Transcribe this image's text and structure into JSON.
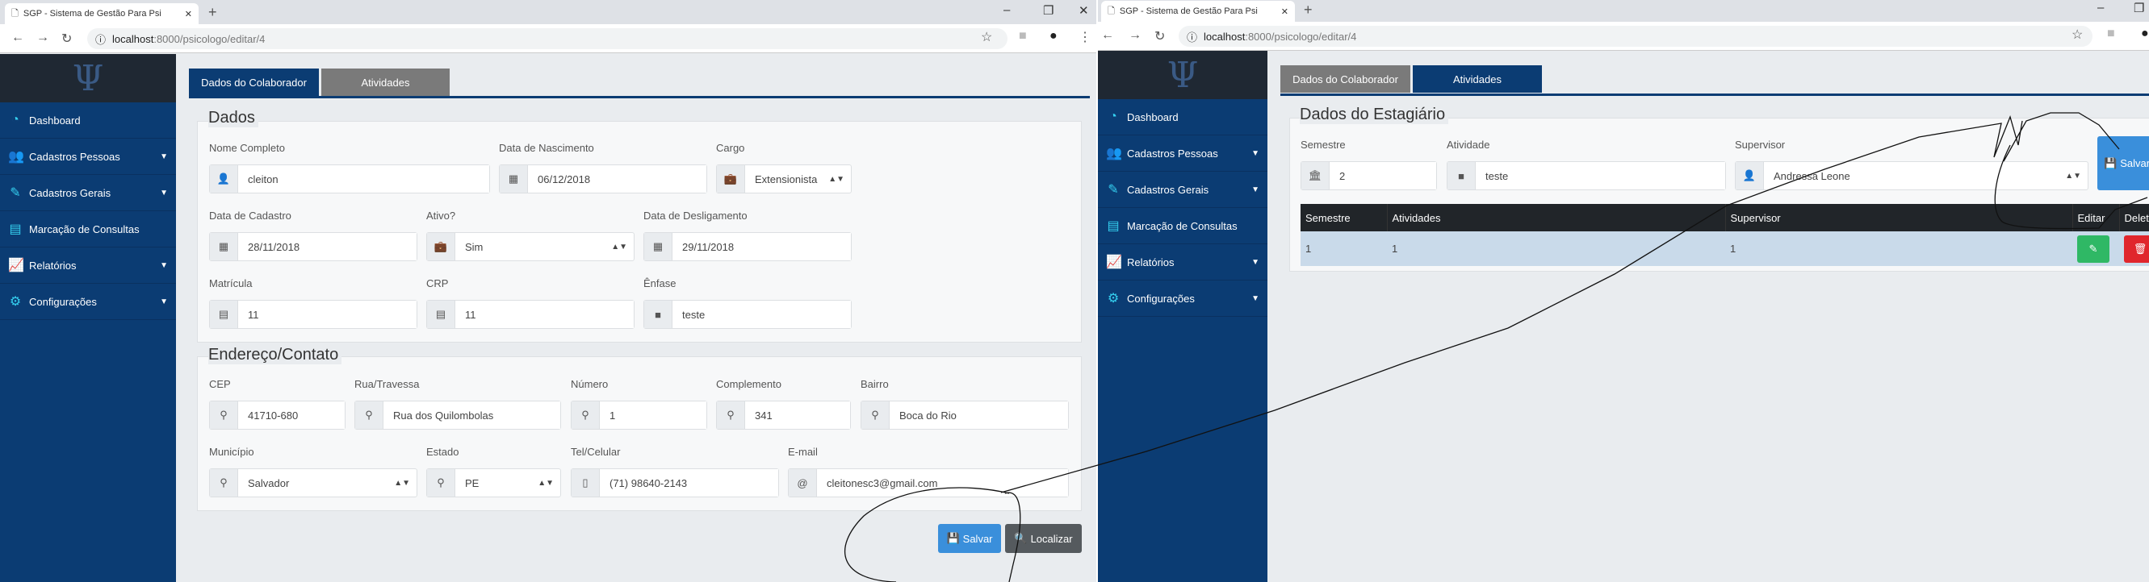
{
  "browser": {
    "tab_title": "SGP - Sistema de Gestão Para Psi",
    "url_host": "localhost",
    "url_path": ":8000/psicologo/editar/4"
  },
  "sidebar": {
    "logo": "Ψ",
    "items": [
      {
        "label": "Dashboard"
      },
      {
        "label": "Cadastros Pessoas"
      },
      {
        "label": "Cadastros Gerais"
      },
      {
        "label": "Marcação de Consultas"
      },
      {
        "label": "Relatórios"
      },
      {
        "label": "Configurações"
      }
    ]
  },
  "page_tabs": [
    "Dados do Colaborador",
    "Atividades"
  ],
  "left": {
    "dados": {
      "legend": "Dados",
      "nome": {
        "label": "Nome Completo",
        "value": "cleiton"
      },
      "nascimento": {
        "label": "Data de Nascimento",
        "value": "06/12/2018"
      },
      "cargo": {
        "label": "Cargo",
        "value": "Extensionista"
      },
      "cadastro": {
        "label": "Data de Cadastro",
        "value": "28/11/2018"
      },
      "ativo": {
        "label": "Ativo?",
        "value": "Sim"
      },
      "desligamento": {
        "label": "Data de Desligamento",
        "value": "29/11/2018"
      },
      "matricula": {
        "label": "Matrícula",
        "value": "11"
      },
      "crp": {
        "label": "CRP",
        "value": "11"
      },
      "enfase": {
        "label": "Ênfase",
        "value": "teste"
      }
    },
    "endereco": {
      "legend": "Endereço/Contato",
      "cep": {
        "label": "CEP",
        "value": "41710-680"
      },
      "rua": {
        "label": "Rua/Travessa",
        "value": "Rua dos Quilombolas"
      },
      "numero": {
        "label": "Número",
        "value": "1"
      },
      "complemento": {
        "label": "Complemento",
        "value": "341"
      },
      "bairro": {
        "label": "Bairro",
        "value": "Boca do Rio"
      },
      "municipio": {
        "label": "Município",
        "value": "Salvador"
      },
      "estado": {
        "label": "Estado",
        "value": "PE"
      },
      "tel": {
        "label": "Tel/Celular",
        "value": "(71) 98640-2143"
      },
      "email": {
        "label": "E-mail",
        "value": "cleitonesc3@gmail.com"
      }
    },
    "buttons": {
      "salvar": "Salvar",
      "localizar": "Localizar"
    }
  },
  "right": {
    "legend": "Dados do Estagiário",
    "semestre": {
      "label": "Semestre",
      "value": "2"
    },
    "atividade": {
      "label": "Atividade",
      "value": "teste"
    },
    "supervisor": {
      "label": "Supervisor",
      "value": "Andressa Leone"
    },
    "salvar": "Salvar",
    "table": {
      "headers": [
        "Semestre",
        "Atividades",
        "Supervisor",
        "Editar",
        "Deletar"
      ],
      "rows": [
        [
          "1",
          "1",
          "1"
        ]
      ]
    }
  },
  "colors": {
    "sidebar": "#0b3c73",
    "primary": "#3a8fdb",
    "success": "#2fb865",
    "danger": "#e0262c"
  }
}
